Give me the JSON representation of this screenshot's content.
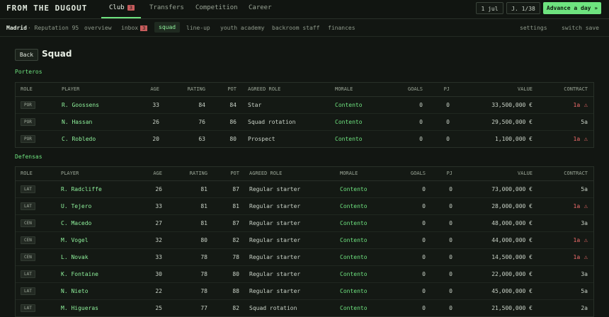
{
  "app": {
    "title": "FROM THE DUGOUT",
    "tabs": [
      {
        "label": "Club",
        "badge": "3"
      },
      {
        "label": "Transfers"
      },
      {
        "label": "Competition"
      },
      {
        "label": "Career"
      }
    ],
    "date": "1 jul",
    "matchday": "J. 1/38",
    "advance_label": "Advance a day »"
  },
  "subnav": {
    "club_name": "Madrid",
    "reputation": "· Reputation 95",
    "items": [
      {
        "label": "overview"
      },
      {
        "label": "inbox",
        "badge": "3"
      },
      {
        "label": "squad"
      },
      {
        "label": "line-up"
      },
      {
        "label": "youth academy"
      },
      {
        "label": "backroom staff"
      },
      {
        "label": "finances"
      }
    ],
    "settings_label": "settings",
    "switch_save_label": "switch save"
  },
  "page": {
    "back_label": "Back",
    "title": "Squad"
  },
  "columns": [
    "ROLE",
    "PLAYER",
    "AGE",
    "RATING",
    "POT",
    "AGREED ROLE",
    "MORALE",
    "GOALS",
    "PJ",
    "VALUE",
    "CONTRACT"
  ],
  "sections": [
    {
      "title": "Porteros",
      "players": [
        {
          "pos": "POR",
          "name": "R. Goossens",
          "age": "33",
          "rating": "84",
          "pot": "84",
          "role": "Star",
          "morale": "Contento",
          "goals": "0",
          "pj": "0",
          "value": "33,500,000 €",
          "contract": "1a",
          "warn": true
        },
        {
          "pos": "POR",
          "name": "N. Hassan",
          "age": "26",
          "rating": "76",
          "pot": "86",
          "role": "Squad rotation",
          "morale": "Contento",
          "goals": "0",
          "pj": "0",
          "value": "29,500,000 €",
          "contract": "5a",
          "warn": false
        },
        {
          "pos": "POR",
          "name": "C. Robledo",
          "age": "20",
          "rating": "63",
          "pot": "80",
          "role": "Prospect",
          "morale": "Contento",
          "goals": "0",
          "pj": "0",
          "value": "1,100,000 €",
          "contract": "1a",
          "warn": true
        }
      ]
    },
    {
      "title": "Defensas",
      "players": [
        {
          "pos": "LAT",
          "name": "R. Radcliffe",
          "age": "26",
          "rating": "81",
          "pot": "87",
          "role": "Regular starter",
          "morale": "Contento",
          "goals": "0",
          "pj": "0",
          "value": "73,000,000 €",
          "contract": "5a",
          "warn": false
        },
        {
          "pos": "LAT",
          "name": "U. Tejero",
          "age": "33",
          "rating": "81",
          "pot": "81",
          "role": "Regular starter",
          "morale": "Contento",
          "goals": "0",
          "pj": "0",
          "value": "28,000,000 €",
          "contract": "1a",
          "warn": true
        },
        {
          "pos": "CEN",
          "name": "C. Macedo",
          "age": "27",
          "rating": "81",
          "pot": "87",
          "role": "Regular starter",
          "morale": "Contento",
          "goals": "0",
          "pj": "0",
          "value": "48,000,000 €",
          "contract": "3a",
          "warn": false
        },
        {
          "pos": "CEN",
          "name": "M. Vogel",
          "age": "32",
          "rating": "80",
          "pot": "82",
          "role": "Regular starter",
          "morale": "Contento",
          "goals": "0",
          "pj": "0",
          "value": "44,000,000 €",
          "contract": "1a",
          "warn": true
        },
        {
          "pos": "CEN",
          "name": "L. Novak",
          "age": "33",
          "rating": "78",
          "pot": "78",
          "role": "Regular starter",
          "morale": "Contento",
          "goals": "0",
          "pj": "0",
          "value": "14,500,000 €",
          "contract": "1a",
          "warn": true
        },
        {
          "pos": "LAT",
          "name": "K. Fontaine",
          "age": "30",
          "rating": "78",
          "pot": "80",
          "role": "Regular starter",
          "morale": "Contento",
          "goals": "0",
          "pj": "0",
          "value": "22,000,000 €",
          "contract": "3a",
          "warn": false
        },
        {
          "pos": "LAT",
          "name": "N. Nieto",
          "age": "22",
          "rating": "78",
          "pot": "88",
          "role": "Regular starter",
          "morale": "Contento",
          "goals": "0",
          "pj": "0",
          "value": "45,000,000 €",
          "contract": "5a",
          "warn": false
        },
        {
          "pos": "LAT",
          "name": "M. Higueras",
          "age": "25",
          "rating": "77",
          "pot": "82",
          "role": "Squad rotation",
          "morale": "Contento",
          "goals": "0",
          "pj": "0",
          "value": "21,500,000 €",
          "contract": "2a",
          "warn": false
        }
      ]
    }
  ],
  "colors": {
    "accent": "#6ee37f",
    "warning": "#ef6b6b",
    "badge": "#c75c5c"
  }
}
